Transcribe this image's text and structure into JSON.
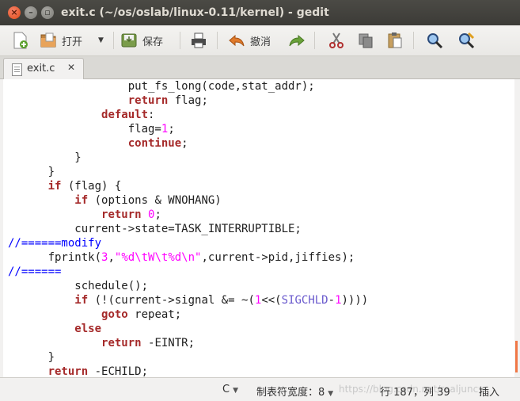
{
  "window": {
    "title": "exit.c (~/os/oslab/linux-0.11/kernel) - gedit"
  },
  "toolbar": {
    "open_label": "打开",
    "save_label": "保存",
    "undo_label": "撤消"
  },
  "tab": {
    "label": "exit.c"
  },
  "editor": {
    "lines": [
      "                  put_fs_long(code,stat_addr);",
      "                  return flag;",
      "              default:",
      "                  flag=1;",
      "                  continue;",
      "          }",
      "      }",
      "      if (flag) {",
      "          if (options & WNOHANG)",
      "              return 0;",
      "          current->state=TASK_INTERRUPTIBLE;",
      "//======modify",
      "      fprintk(3,\"%d\\tW\\t%d\\n\",current->pid,jiffies);",
      "//======",
      "          schedule();",
      "          if (!(current->signal &= ~(1<<(SIGCHLD-1))))",
      "              goto repeat;",
      "          else",
      "              return -EINTR;",
      "      }",
      "      return -ECHILD;"
    ]
  },
  "statusbar": {
    "language": "C",
    "tab_width": "制表符宽度：8",
    "position": "行 187，列 39",
    "mode": "插入",
    "watermark": "https://blog.csdn.net/realjuncy"
  }
}
